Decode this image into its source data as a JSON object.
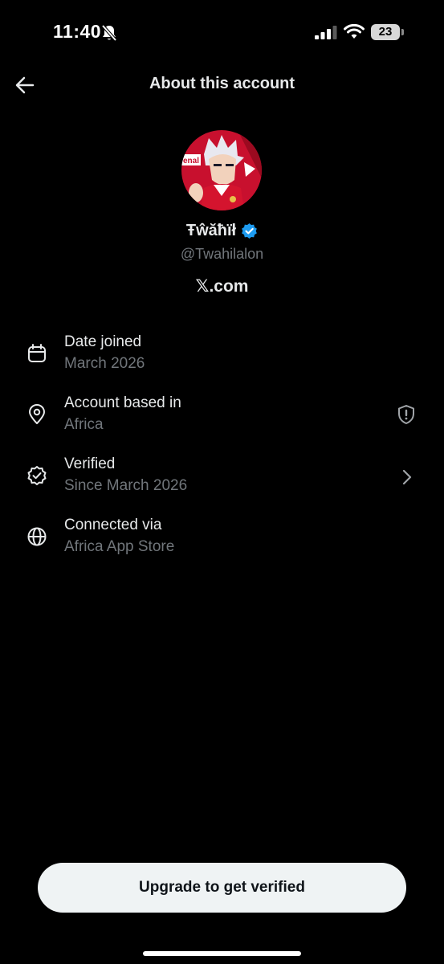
{
  "status_bar": {
    "time": "11:40",
    "battery_level": "23",
    "icons": [
      "bell-slash-icon",
      "signal-icon",
      "wifi-icon",
      "battery-icon"
    ]
  },
  "header": {
    "title": "About this account",
    "back_icon": "arrow-left-icon"
  },
  "profile": {
    "display_name": "Ŧŵăħïł",
    "username": "@Twahilalon",
    "site": "𝕏.com",
    "verified_badge_color": "#1d9bf0"
  },
  "info_rows": [
    {
      "icon": "calendar-icon",
      "title": "Date joined",
      "value": "March 2026"
    },
    {
      "icon": "location-pin-icon",
      "title": "Account based in",
      "value": "Africa",
      "trailing_icon": "shield-alert-icon"
    },
    {
      "icon": "verified-check-icon",
      "title": "Verified",
      "value": "Since March 2026",
      "trailing_icon": "chevron-right-icon"
    },
    {
      "icon": "globe-icon",
      "title": "Connected via",
      "value": "Africa App Store"
    }
  ],
  "actions": {
    "upgrade_label": "Upgrade to get verified"
  },
  "colors": {
    "background": "#000000",
    "primary_text": "#e7e9ea",
    "secondary_text": "#71767b",
    "button_bg": "#eff3f4",
    "button_text": "#0f1419"
  }
}
